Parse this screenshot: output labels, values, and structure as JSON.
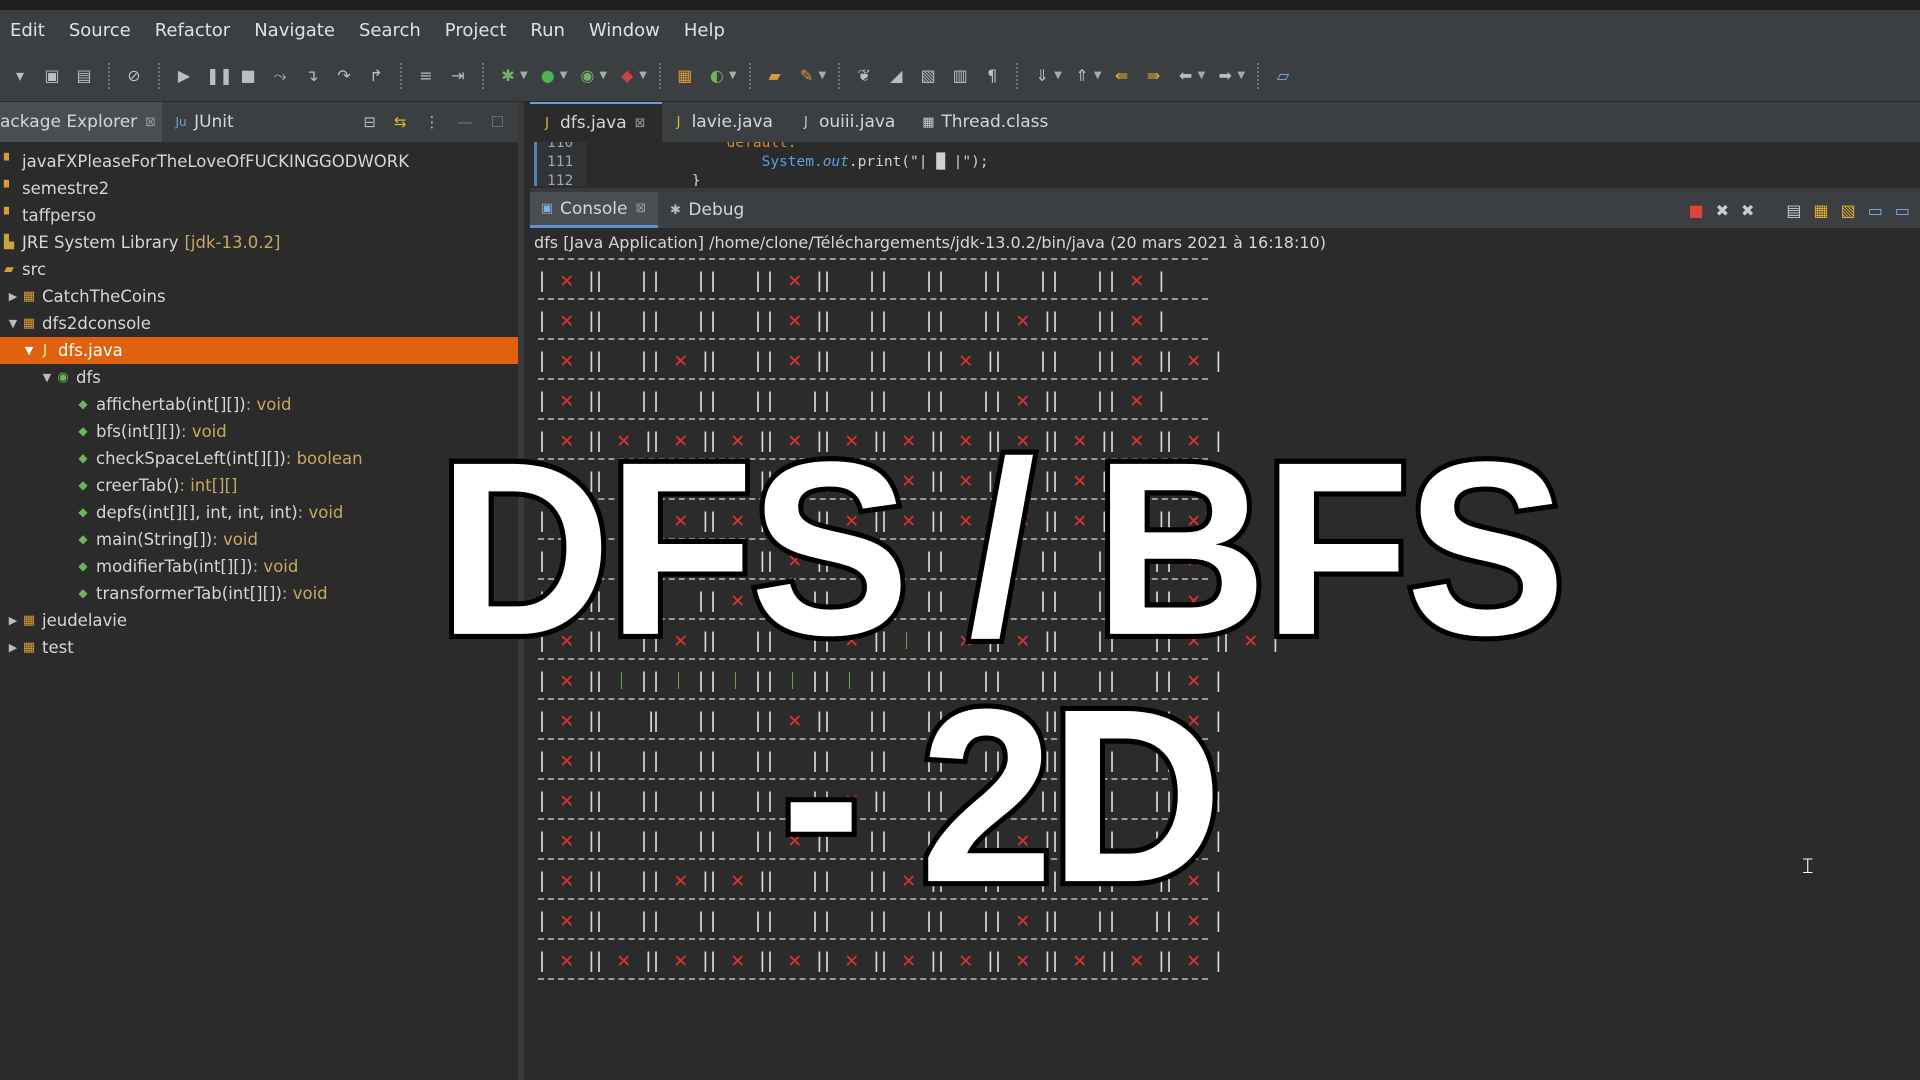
{
  "menu": [
    "Edit",
    "Source",
    "Refactor",
    "Navigate",
    "Search",
    "Project",
    "Run",
    "Window",
    "Help"
  ],
  "left_panel": {
    "tabs": [
      {
        "label": "ackage Explorer",
        "active": true
      },
      {
        "label": "JUnit",
        "active": false
      }
    ],
    "tree": [
      {
        "label": "javaFXPleaseForTheLoveOfFUCKINGGODWORK",
        "indent": 0,
        "icon": "project-icon"
      },
      {
        "label": "semestre2",
        "indent": 0,
        "icon": "project-icon"
      },
      {
        "label": "taffperso",
        "indent": 0,
        "icon": "project-icon"
      },
      {
        "label": "JRE System Library",
        "decoration": "[jdk-13.0.2]",
        "indent": 0,
        "icon": "library-icon"
      },
      {
        "label": "src",
        "indent": 0,
        "icon": "source-folder-icon"
      },
      {
        "label": "CatchTheCoins",
        "indent": 1,
        "icon": "package-icon",
        "arrow": "collapsed"
      },
      {
        "label": "dfs2dconsole",
        "indent": 1,
        "icon": "package-icon",
        "arrow": "expanded"
      },
      {
        "label": "dfs.java",
        "indent": 2,
        "icon": "java-file-icon",
        "arrow": "expanded",
        "selected": true
      },
      {
        "label": "dfs",
        "indent": 3,
        "icon": "class-icon",
        "arrow": "expanded"
      },
      {
        "label": "affichertab(int[][])",
        "decoration": " : void",
        "indent": 4,
        "icon": "method-icon"
      },
      {
        "label": "bfs(int[][])",
        "decoration": " : void",
        "indent": 4,
        "icon": "method-icon"
      },
      {
        "label": "checkSpaceLeft(int[][])",
        "decoration": " : boolean",
        "indent": 4,
        "icon": "method-icon"
      },
      {
        "label": "creerTab()",
        "decoration": " : int[][]",
        "indent": 4,
        "icon": "method-icon"
      },
      {
        "label": "depfs(int[][], int, int, int)",
        "decoration": " : void",
        "indent": 4,
        "icon": "method-icon"
      },
      {
        "label": "main(String[])",
        "decoration": " : void",
        "indent": 4,
        "icon": "method-icon"
      },
      {
        "label": "modifierTab(int[][])",
        "decoration": " : void",
        "indent": 4,
        "icon": "method-icon"
      },
      {
        "label": "transformerTab(int[][])",
        "decoration": " : void",
        "indent": 4,
        "icon": "method-icon"
      },
      {
        "label": "jeudelavie",
        "indent": 1,
        "icon": "package-icon",
        "arrow": "collapsed"
      },
      {
        "label": "test",
        "indent": 1,
        "icon": "package-icon",
        "arrow": "collapsed"
      }
    ]
  },
  "editor": {
    "tabs": [
      {
        "label": "dfs.java",
        "active": true
      },
      {
        "label": "lavie.java",
        "active": false
      },
      {
        "label": "ouiii.java",
        "active": false
      },
      {
        "label": "Thread.class",
        "active": false
      }
    ],
    "lines": [
      {
        "num": "110",
        "code": "                default:"
      },
      {
        "num": "111",
        "code_prefix": "                    System.",
        "code_field": "out",
        "code_suffix": ".print(\"| █ |\");"
      },
      {
        "num": "112",
        "code": "            }"
      }
    ]
  },
  "console": {
    "tabs": [
      {
        "label": "Console",
        "active": true
      },
      {
        "label": "Debug",
        "active": false
      }
    ],
    "launch": "dfs [Java Application] /home/clone/Téléchargements/jdk-13.0.2/bin/java  (20 mars 2021 à 16:18:10)",
    "grid": [
      "X...X.....X",
      "X...X...X.X",
      "X.X.X..X..XX",
      "X.......X.X",
      "XXXXXXXXXXXX",
      "XXXXXXXXXXXX",
      "XXXXXXXXXXXX",
      "X.XXXX.....X",
      "X..X.......X",
      "X.X..XGXX..XX",
      "XGGGGG.....X",
      "XW..X...X..X",
      "X.......X..X",
      "X....X.....X",
      "X...X...X..X",
      "X.XX..X...XX",
      "X.......X..X",
      "XXXXXXXXXXXX"
    ]
  },
  "overlay": {
    "title": "DFS / BFS - 2D"
  }
}
